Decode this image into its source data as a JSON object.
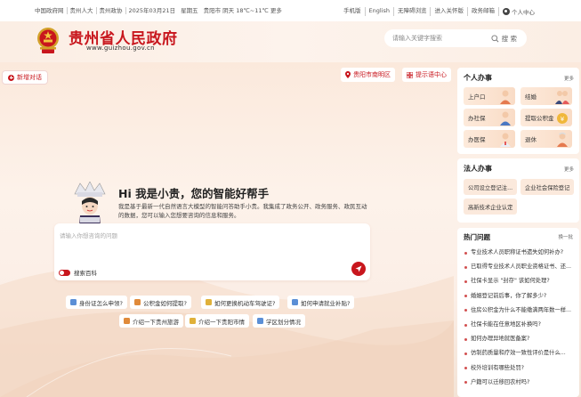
{
  "topbar": {
    "links_left": [
      "中国政府网",
      "贵州人大",
      "贵州政协",
      "2025年03月21日",
      "星期五",
      "贵阳市 阴天 18℃~11℃ 更多"
    ],
    "links_right": [
      "手机版",
      "English",
      "无障碍浏览",
      "进入关怀版",
      "政务邮箱"
    ],
    "user_center": "个人中心"
  },
  "header": {
    "title": "贵州省人民政府",
    "url": "www.guizhou.gov.cn",
    "search_placeholder": "请输入关键字搜索",
    "search_button": "搜 索"
  },
  "main": {
    "new_chat": "新增对话",
    "location": "贵阳市南明区",
    "tips": "提示语中心",
    "greeting": "Hi 我是小贵，您的智能好帮手",
    "intro": "我是基于最新一代自然语言大模型的智能问答助手小贵。我集成了政务公开、政务服务、政民互动的数据，您可以输入您想要咨询的信息和服务。",
    "input_placeholder": "请输入你想咨询的问题",
    "toggle_label": "搜索百科",
    "suggestions_row1": [
      "身份证怎么申领?",
      "公积金如何提取?",
      "如何更换机动车驾驶证?",
      "如何申请就业补贴?"
    ],
    "suggestions_row2": [
      "介绍一下贵州旅游",
      "介绍一下贵阳市情",
      "学区划分情况"
    ]
  },
  "personal": {
    "title": "个人办事",
    "more": "更多",
    "services": [
      "上户口",
      "结婚",
      "办社保",
      "提取公积金",
      "办医保",
      "退休"
    ]
  },
  "legal": {
    "title": "法人办事",
    "more": "更多",
    "services": [
      "公司设立登记注...",
      "企业社会保险登记",
      "高新技术企业认定"
    ]
  },
  "hot": {
    "title": "热门问题",
    "switch": "换一批",
    "items": [
      "专业技术人员职称证书遗失如何补办?",
      "已取得专业技术人员职业资格证书、还...",
      "社保卡显示 \"封存\" 该如何处理?",
      "婚姻登记前后事，你了解多少?",
      "住房公积金为什么不能缴满两年数一样...",
      "社保卡能在任意地区补换吗?",
      "如何办理异地就医备案?",
      "仿制药质量和疗效一致性评价是什么...",
      "校外培训有哪些处罚?",
      "户籍可以迁移回农村吗?"
    ]
  },
  "colors": {
    "brand": "#c8161d",
    "bg": "#fbeee4"
  }
}
